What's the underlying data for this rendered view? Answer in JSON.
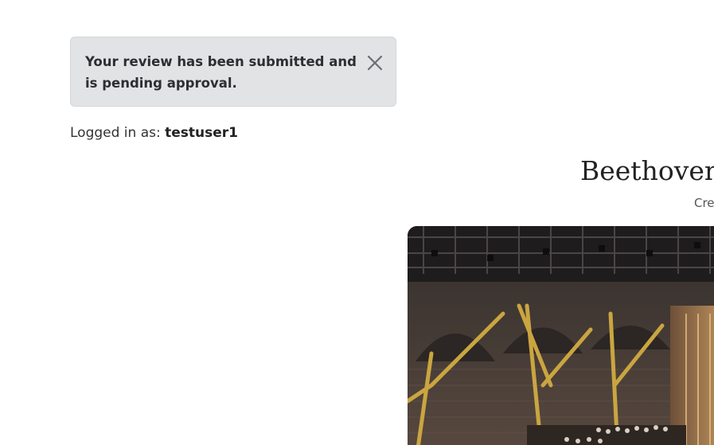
{
  "alert": {
    "message": "Your review has been submitted and is pending approval.",
    "close_icon": "close-icon"
  },
  "session": {
    "prefix": "Logged in as: ",
    "username": "testuser1"
  },
  "event": {
    "title": "Beethoven'",
    "credit_fragment": "Cre"
  },
  "hero_image": {
    "icon": "concert-hall-image"
  },
  "colors": {
    "alert_bg": "#e2e3e5",
    "alert_border": "#d3d6d8",
    "text": "#212529"
  }
}
